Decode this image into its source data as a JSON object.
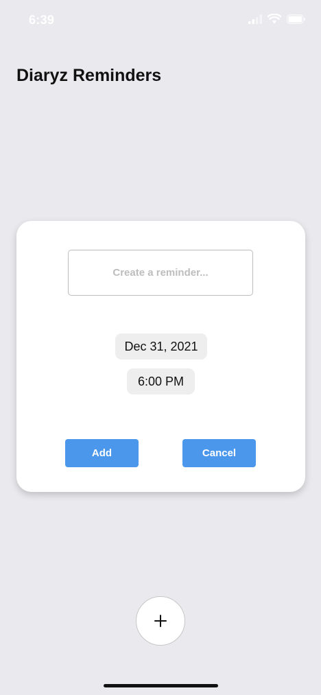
{
  "status_bar": {
    "time": "6:39",
    "icons": [
      "signal-icon",
      "wifi-icon",
      "battery-icon"
    ]
  },
  "header": {
    "title": "Diaryz Reminders"
  },
  "reminder_card": {
    "input_value": "",
    "input_placeholder": "Create a reminder...",
    "date": "Dec 31, 2021",
    "time": "6:00 PM",
    "add_label": "Add",
    "cancel_label": "Cancel"
  },
  "fab": {
    "icon": "plus-icon"
  },
  "colors": {
    "background": "#e9e9ee",
    "card": "#ffffff",
    "button": "#4a97ec",
    "pill": "#eeeeef"
  }
}
